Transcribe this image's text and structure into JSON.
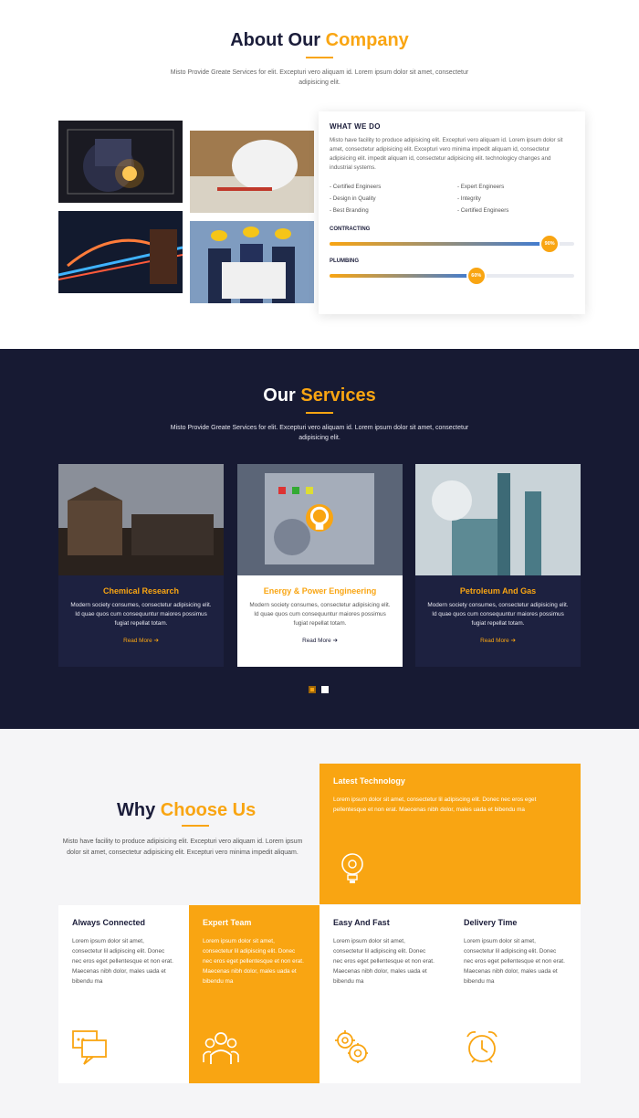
{
  "about": {
    "title_main": "About Our",
    "title_accent": "Company",
    "subtitle": "Misto Provide Greate Services for elit. Excepturi vero aliquam id. Lorem ipsum dolor sit amet, consectetur adipisicing elit.",
    "card_heading": "WHAT WE DO",
    "card_text": "Misto have facility to produce adipisicing elit. Excepturi vero aliquam id. Lorem ipsum dolor sit amet, consectetur adipisicing elit. Excepturi vero minima impedit aliquam id, consectetur adipisicing elit. impedit aliquam id, consectetur adipisicing elit. technologicy changes and industrial systems.",
    "features": [
      "- Certified Engineers",
      "- Expert Engineers",
      "- Design in Quality",
      "- Integrity",
      "- Best Branding",
      "- Certified Engineers"
    ],
    "progress": [
      {
        "label": "CONTRACTING",
        "value": 90,
        "text": "90%"
      },
      {
        "label": "PLUMBING",
        "value": 60,
        "text": "60%"
      }
    ]
  },
  "services": {
    "title_main": "Our",
    "title_accent": "Services",
    "subtitle": "Misto Provide Greate Services for elit. Excepturi vero aliquam id. Lorem ipsum dolor sit amet, consectetur adipisicing elit.",
    "items": [
      {
        "title": "Chemical Research",
        "desc": "Modern society consumes, consectetur adipisicing elit. Id quae quos cum consequuntur maiores possimus fugiat repellat totam.",
        "link": "Read More ➔"
      },
      {
        "title": "Energy & Power Engineering",
        "desc": "Modern society consumes, consectetur adipisicing elit. Id quae quos cum consequuntur maiores possimus fugiat repellat totam.",
        "link": "Read More ➔"
      },
      {
        "title": "Petroleum And Gas",
        "desc": "Modern society consumes, consectetur adipisicing elit. Id quae quos cum consequuntur maiores possimus fugiat repellat totam.",
        "link": "Read More ➔"
      }
    ]
  },
  "why": {
    "title_main": "Why",
    "title_accent": "Choose Us",
    "text": "Misto have facility to produce adipisicing elit. Excepturi vero aliquam id. Lorem ipsum dolor sit amet, consectetur adipisicing elit. Excepturi vero minima impedit aliquam.",
    "latest": {
      "title": "Latest Technology",
      "text": "Lorem ipsum dolor sit amet, consectetur lil adipiscing elit. Donec nec eros eget pellentesque et non erat. Maecenas nibh dolor, males uada et bibendu ma"
    },
    "tiles": [
      {
        "title": "Always Connected",
        "text": "Lorem ipsum dolor sit amet, consectetur lil adipiscing elit. Donec nec eros eget pellentesque et non erat. Maecenas nibh dolor, males uada et bibendu ma"
      },
      {
        "title": "Expert Team",
        "text": "Lorem ipsum dolor sit amet, consectetur lil adipiscing elit. Donec nec eros eget pellentesque et non erat. Maecenas nibh dolor, males uada et bibendu ma"
      },
      {
        "title": "Easy And Fast",
        "text": "Lorem ipsum dolor sit amet, consectetur lil adipiscing elit. Donec nec eros eget pellentesque et non erat. Maecenas nibh dolor, males uada et bibendu ma"
      },
      {
        "title": "Delivery Time",
        "text": "Lorem ipsum dolor sit amet, consectetur lil adipiscing elit. Donec nec eros eget pellentesque et non erat. Maecenas nibh dolor, males uada et bibendu ma"
      }
    ]
  },
  "colors": {
    "accent": "#f9a512",
    "navy": "#171a33"
  },
  "icons": [
    "bulb-gear-icon",
    "chat-icon",
    "team-icon",
    "gears-icon",
    "alarm-clock-icon"
  ]
}
